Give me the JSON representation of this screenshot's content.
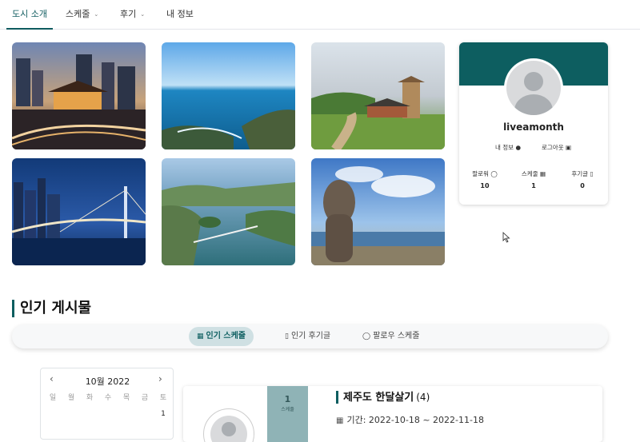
{
  "nav": {
    "items": [
      {
        "label": "도시 소개",
        "dropdown": false,
        "active": true
      },
      {
        "label": "스케줄",
        "dropdown": true,
        "active": false
      },
      {
        "label": "후기",
        "dropdown": true,
        "active": false
      },
      {
        "label": "내 정보",
        "dropdown": false,
        "active": false
      }
    ]
  },
  "photos": [
    {
      "name": "seoul-night-gate-photo"
    },
    {
      "name": "ocean-coast-photo"
    },
    {
      "name": "temple-pagoda-photo"
    },
    {
      "name": "busan-bridge-night-photo"
    },
    {
      "name": "harbor-islands-photo"
    },
    {
      "name": "jeju-stone-statue-photo"
    }
  ],
  "profile": {
    "username": "liveamonth",
    "my_info_link": "내 정보",
    "logout_link": "로그아웃",
    "stats": [
      {
        "label": "팔로워",
        "value": "10",
        "icon": "user-icon"
      },
      {
        "label": "스케줄",
        "value": "1",
        "icon": "calendar-icon"
      },
      {
        "label": "후기글",
        "value": "0",
        "icon": "book-icon"
      }
    ]
  },
  "popular": {
    "title": "인기 게시물",
    "tabs": [
      {
        "label": "인기 스케줄",
        "icon": "calendar-icon",
        "active": true
      },
      {
        "label": "인기 후기글",
        "icon": "book-icon",
        "active": false
      },
      {
        "label": "팔로우 스케줄",
        "icon": "user-icon",
        "active": false
      }
    ]
  },
  "calendar": {
    "month_label": "10월 2022",
    "weekdays": [
      "일",
      "월",
      "화",
      "수",
      "목",
      "금",
      "토"
    ],
    "first_row": [
      "",
      "",
      "",
      "",
      "",
      "",
      "1"
    ]
  },
  "schedule_card": {
    "day_number": "1",
    "day_label": "스케줄",
    "title": "제주도 한달살기",
    "count": "(4)",
    "period": "기간: 2022-10-18 ~ 2022-11-18"
  },
  "colors": {
    "accent": "#0d5e60",
    "tab_active_bg": "#cfe0e3",
    "day_box": "#8fb3b6"
  }
}
